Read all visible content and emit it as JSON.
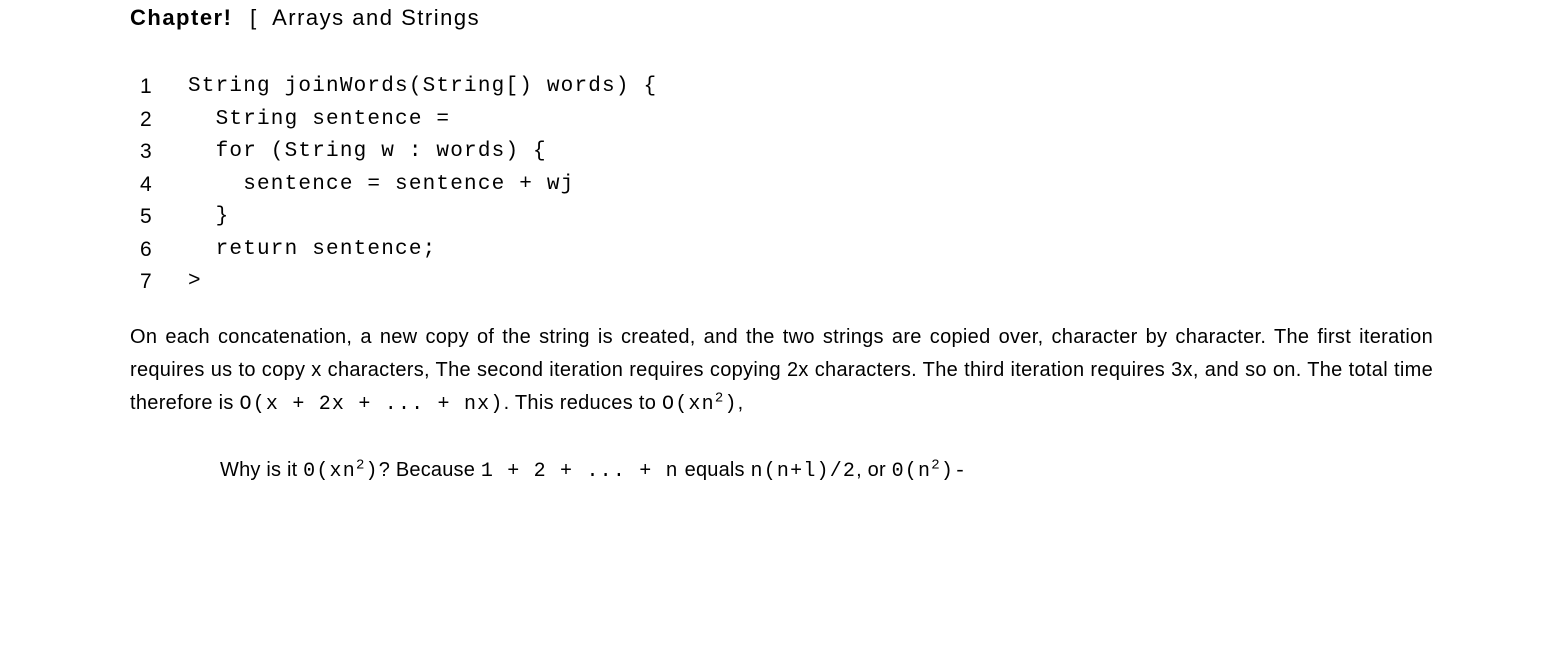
{
  "header": {
    "label": "Chapter!",
    "bracket": "[",
    "title": "Arrays and Strings"
  },
  "code": {
    "lines": [
      {
        "n": "1",
        "text": "String joinWords(String[) words) {"
      },
      {
        "n": "2",
        "text": "  String sentence ="
      },
      {
        "n": "3",
        "text": "  for (String w : words) {"
      },
      {
        "n": "4",
        "text": "    sentence = sentence + wj"
      },
      {
        "n": "5",
        "text": "  }"
      },
      {
        "n": "6",
        "text": "  return sentence;"
      },
      {
        "n": "7",
        "text": ">"
      }
    ]
  },
  "para": {
    "p1a": "On each concatenation, a new copy of the string is created, and the two strings are copied over, character by character. The first iteration requires us to copy x characters, The second iteration requires copying 2x characters. The third iteration requires 3x, and so on. The total time therefore is",
    "p1m1": "O(x + 2x + ... + nx)",
    "p1b": ". This reduces to",
    "p1m2a": "O(xn",
    "p1m2sup": "2",
    "p1m2b": ")",
    "p1c": ","
  },
  "note": {
    "n1": "Why is it ",
    "m1a": "0(xn",
    "m1sup": "2",
    "m1b": ")",
    "n2": "? Because ",
    "m2": "1 + 2 + ... + n",
    "n3": " equals ",
    "m3": "n(n+l)/2",
    "n4": ", or ",
    "m4a": "0(n",
    "m4sup": "2",
    "m4b": ")-"
  }
}
